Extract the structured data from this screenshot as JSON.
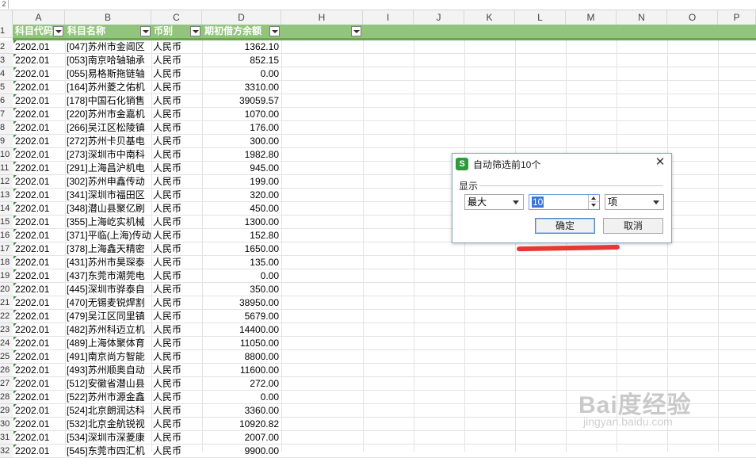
{
  "top_strip_label": "2",
  "columns": [
    "A",
    "B",
    "C",
    "D",
    "H",
    "I",
    "J",
    "K",
    "L",
    "M",
    "N",
    "O",
    "P"
  ],
  "header": {
    "a": "科目代码",
    "b": "科目名称",
    "c": "币别",
    "d": "期初借方余额"
  },
  "rows": [
    {
      "n": "2",
      "a": "2202.01",
      "b": "[047]苏州市金阊区",
      "c": "人民币",
      "d": "1362.10"
    },
    {
      "n": "3",
      "a": "2202.01",
      "b": "[053]南京哈轴轴承",
      "c": "人民币",
      "d": "852.15"
    },
    {
      "n": "4",
      "a": "2202.01",
      "b": "[055]易格斯拖链轴",
      "c": "人民币",
      "d": "0.00"
    },
    {
      "n": "5",
      "a": "2202.01",
      "b": "[164]苏州菱之佑机",
      "c": "人民币",
      "d": "3310.00"
    },
    {
      "n": "6",
      "a": "2202.01",
      "b": "[178]中国石化销售",
      "c": "人民币",
      "d": "39059.57"
    },
    {
      "n": "7",
      "a": "2202.01",
      "b": "[220]苏州市金嘉机",
      "c": "人民币",
      "d": "1070.00"
    },
    {
      "n": "8",
      "a": "2202.01",
      "b": "[266]吴江区松陵镇",
      "c": "人民币",
      "d": "176.00"
    },
    {
      "n": "9",
      "a": "2202.01",
      "b": "[272]苏州卡贝基电",
      "c": "人民币",
      "d": "300.00"
    },
    {
      "n": "10",
      "a": "2202.01",
      "b": "[273]深圳市中南科",
      "c": "人民币",
      "d": "1982.80"
    },
    {
      "n": "11",
      "a": "2202.01",
      "b": "[291]上海昌沪机电",
      "c": "人民币",
      "d": "945.00"
    },
    {
      "n": "12",
      "a": "2202.01",
      "b": "[302]苏州申鑫传动",
      "c": "人民币",
      "d": "199.00"
    },
    {
      "n": "13",
      "a": "2202.01",
      "b": "[341]深圳市福田区",
      "c": "人民币",
      "d": "320.00"
    },
    {
      "n": "14",
      "a": "2202.01",
      "b": "[348]潜山县聚亿刷",
      "c": "人民币",
      "d": "450.00"
    },
    {
      "n": "15",
      "a": "2202.01",
      "b": "[355]上海屹实机械",
      "c": "人民币",
      "d": "1300.00"
    },
    {
      "n": "16",
      "a": "2202.01",
      "b": "[371]平临(上海)传动",
      "c": "人民币",
      "d": "152.80"
    },
    {
      "n": "17",
      "a": "2202.01",
      "b": "[378]上海鑫天精密",
      "c": "人民币",
      "d": "1650.00"
    },
    {
      "n": "18",
      "a": "2202.01",
      "b": "[431]苏州市昊琛泰",
      "c": "人民币",
      "d": "135.00"
    },
    {
      "n": "19",
      "a": "2202.01",
      "b": "[437]东莞市潮莞电",
      "c": "人民币",
      "d": "0.00"
    },
    {
      "n": "20",
      "a": "2202.01",
      "b": "[445]深圳市骅泰自",
      "c": "人民币",
      "d": "350.00"
    },
    {
      "n": "21",
      "a": "2202.01",
      "b": "[470]无锡麦锐焊割",
      "c": "人民币",
      "d": "38950.00"
    },
    {
      "n": "22",
      "a": "2202.01",
      "b": "[479]吴江区同里镇",
      "c": "人民币",
      "d": "5679.00"
    },
    {
      "n": "23",
      "a": "2202.01",
      "b": "[482]苏州科迈立机",
      "c": "人民币",
      "d": "14400.00"
    },
    {
      "n": "24",
      "a": "2202.01",
      "b": "[489]上海体聚体育",
      "c": "人民币",
      "d": "11050.00"
    },
    {
      "n": "25",
      "a": "2202.01",
      "b": "[491]南京尚方智能",
      "c": "人民币",
      "d": "8800.00"
    },
    {
      "n": "26",
      "a": "2202.01",
      "b": "[493]苏州顺奥自动",
      "c": "人民币",
      "d": "11600.00"
    },
    {
      "n": "27",
      "a": "2202.01",
      "b": "[512]安徽省潜山县",
      "c": "人民币",
      "d": "272.00"
    },
    {
      "n": "28",
      "a": "2202.01",
      "b": "[522]苏州市源金鑫",
      "c": "人民币",
      "d": "0.00"
    },
    {
      "n": "29",
      "a": "2202.01",
      "b": "[524]北京朗润达科",
      "c": "人民币",
      "d": "3360.00"
    },
    {
      "n": "30",
      "a": "2202.01",
      "b": "[532]北京金航锐视",
      "c": "人民币",
      "d": "10920.82"
    },
    {
      "n": "31",
      "a": "2202.01",
      "b": "[534]深圳市深菱康",
      "c": "人民币",
      "d": "2007.00"
    },
    {
      "n": "32",
      "a": "2202.01",
      "b": "[545]东莞市四汇机",
      "c": "人民币",
      "d": "9900.00"
    }
  ],
  "dialog": {
    "title": "自动筛选前10个",
    "section_label": "显示",
    "mode_value": "最大",
    "count_value": "10",
    "unit_value": "项",
    "ok_label": "确定",
    "cancel_label": "取消",
    "close_symbol": "✕",
    "icon_letter": "S"
  },
  "watermark": {
    "line1": "Bai度经验",
    "line2": "jingyan.baidu.com"
  },
  "colors": {
    "header_green": "#93c47d",
    "header_border": "#6aa84f",
    "annotation_red": "#e53935",
    "dialog_border": "#8aa6c6"
  }
}
